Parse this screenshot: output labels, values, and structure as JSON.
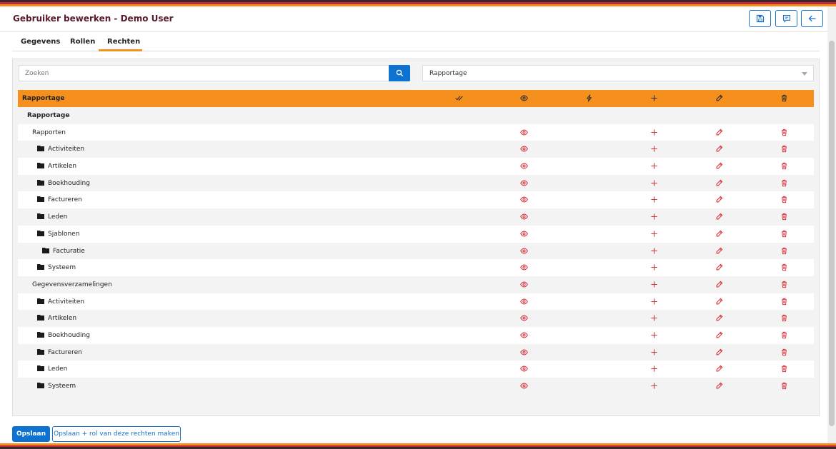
{
  "header": {
    "title": "Gebruiker bewerken - Demo User",
    "accent_color": "#f5901e",
    "primary_color": "#0e72d0"
  },
  "tabs": [
    {
      "label": "Gegevens",
      "active": false
    },
    {
      "label": "Rollen",
      "active": false
    },
    {
      "label": "Rechten",
      "active": true
    }
  ],
  "search": {
    "placeholder": "Zoeken",
    "value": ""
  },
  "module_select": {
    "selected": "Rapportage"
  },
  "table": {
    "header_label": "Rapportage",
    "columns": [
      "check-all-icon",
      "eye-icon",
      "bolt-icon",
      "plus-icon",
      "pencil-icon",
      "trash-icon"
    ],
    "rows": [
      {
        "label": "Rapportage",
        "kind": "group"
      },
      {
        "label": "Rapporten",
        "kind": "sub"
      },
      {
        "label": "Activiteiten",
        "kind": "folder1"
      },
      {
        "label": "Artikelen",
        "kind": "folder1"
      },
      {
        "label": "Boekhouding",
        "kind": "folder1"
      },
      {
        "label": "Factureren",
        "kind": "folder1"
      },
      {
        "label": "Leden",
        "kind": "folder1"
      },
      {
        "label": "Sjablonen",
        "kind": "folder1"
      },
      {
        "label": "Facturatie",
        "kind": "folder2"
      },
      {
        "label": "Systeem",
        "kind": "folder1"
      },
      {
        "label": "Gegevensverzamelingen",
        "kind": "sub"
      },
      {
        "label": "Activiteiten",
        "kind": "folder1"
      },
      {
        "label": "Artikelen",
        "kind": "folder1"
      },
      {
        "label": "Boekhouding",
        "kind": "folder1"
      },
      {
        "label": "Factureren",
        "kind": "folder1"
      },
      {
        "label": "Leden",
        "kind": "folder1"
      },
      {
        "label": "Systeem",
        "kind": "folder1"
      }
    ]
  },
  "footer": {
    "save_label": "Opslaan",
    "save_role_label": "Opslaan + rol van deze rechten maken"
  }
}
